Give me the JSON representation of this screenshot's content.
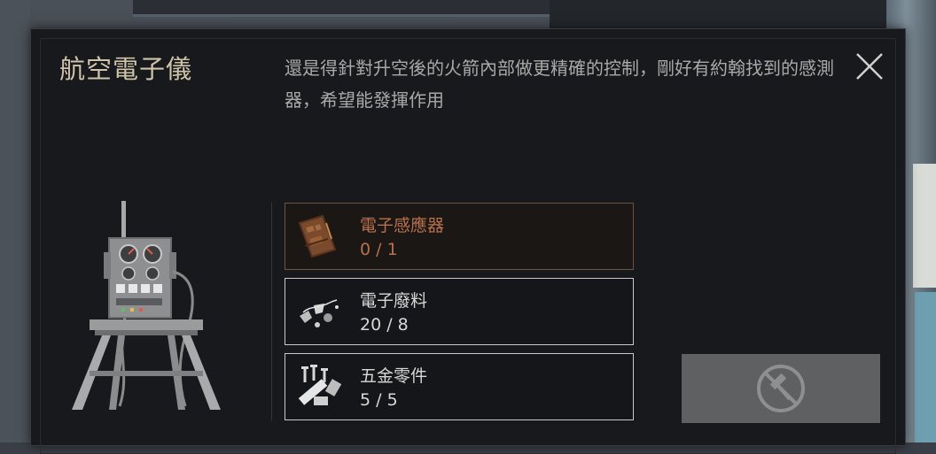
{
  "dialog": {
    "title": "航空電子儀",
    "description": "還是得針對升空後的火箭內部做更精確的控制，剛好有約翰找到的感測器，希望能發揮作用",
    "close_icon": "close-icon"
  },
  "requirements": [
    {
      "name": "電子感應器",
      "count": "0 / 1",
      "status": "missing",
      "icon": "circuit-board-icon"
    },
    {
      "name": "電子廢料",
      "count": "20 / 8",
      "status": "ok",
      "icon": "electronic-scrap-icon"
    },
    {
      "name": "五金零件",
      "count": "5 / 5",
      "status": "ok",
      "icon": "hardware-parts-icon"
    }
  ],
  "craft_button": {
    "icon": "no-build-hammer-icon",
    "enabled": false
  },
  "colors": {
    "title": "#cfc3a8",
    "missing": "#b8704a",
    "panel": "#17191d",
    "disabled_button": "#5f6061"
  }
}
